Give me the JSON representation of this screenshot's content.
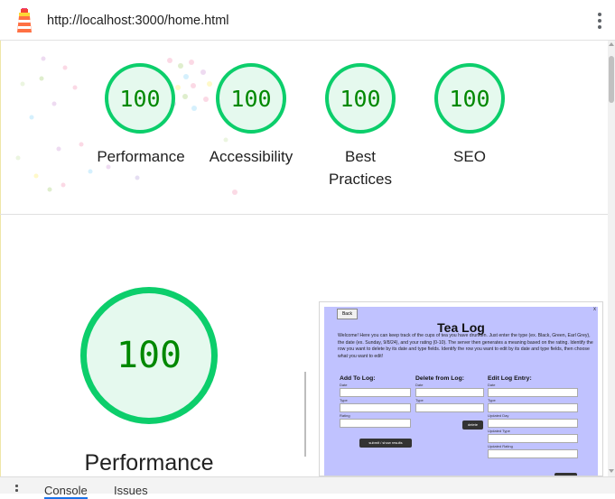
{
  "browser": {
    "url": "http://localhost:3000/home.html"
  },
  "scores": [
    {
      "label": "Performance",
      "score": "100"
    },
    {
      "label": "Accessibility",
      "score": "100"
    },
    {
      "label": "Best Practices",
      "score": "100"
    },
    {
      "label": "SEO",
      "score": "100"
    }
  ],
  "performance_section": {
    "score": "100",
    "label": "Performance"
  },
  "screenshot": {
    "back_label": "Back",
    "close_label": "x",
    "title": "Tea Log",
    "intro": "Welcome! Here you can keep track of the cups of tea you have drunken. Just enter the type (ex. Black, Green, Earl Grey), the date (ex. Sunday, 9/8/24), and your rating (0-10). The server then generates a meaning based on the rating. Identify the row you want to delete by its date and type fields. Identify the row you want to edit by its date and type fields, then choose what you want to edit!",
    "add": {
      "heading": "Add To Log:",
      "fields": [
        "Date",
        "Type",
        "Rating"
      ],
      "button": "submit / show results"
    },
    "delete": {
      "heading": "Delete from Log:",
      "fields": [
        "Date",
        "Type"
      ],
      "button": "delete"
    },
    "edit": {
      "heading": "Edit Log Entry:",
      "fields": [
        "Date",
        "Type",
        "Updated Day",
        "Updated Type",
        "Updated Rating"
      ]
    }
  },
  "devtools_drawer": {
    "tabs": [
      "Console",
      "Issues"
    ]
  },
  "colors": {
    "pass_green": "#0cce6b",
    "pass_text": "#008800",
    "pass_fill": "#e5f9ee",
    "thumb_bg": "#c0c2ff"
  }
}
